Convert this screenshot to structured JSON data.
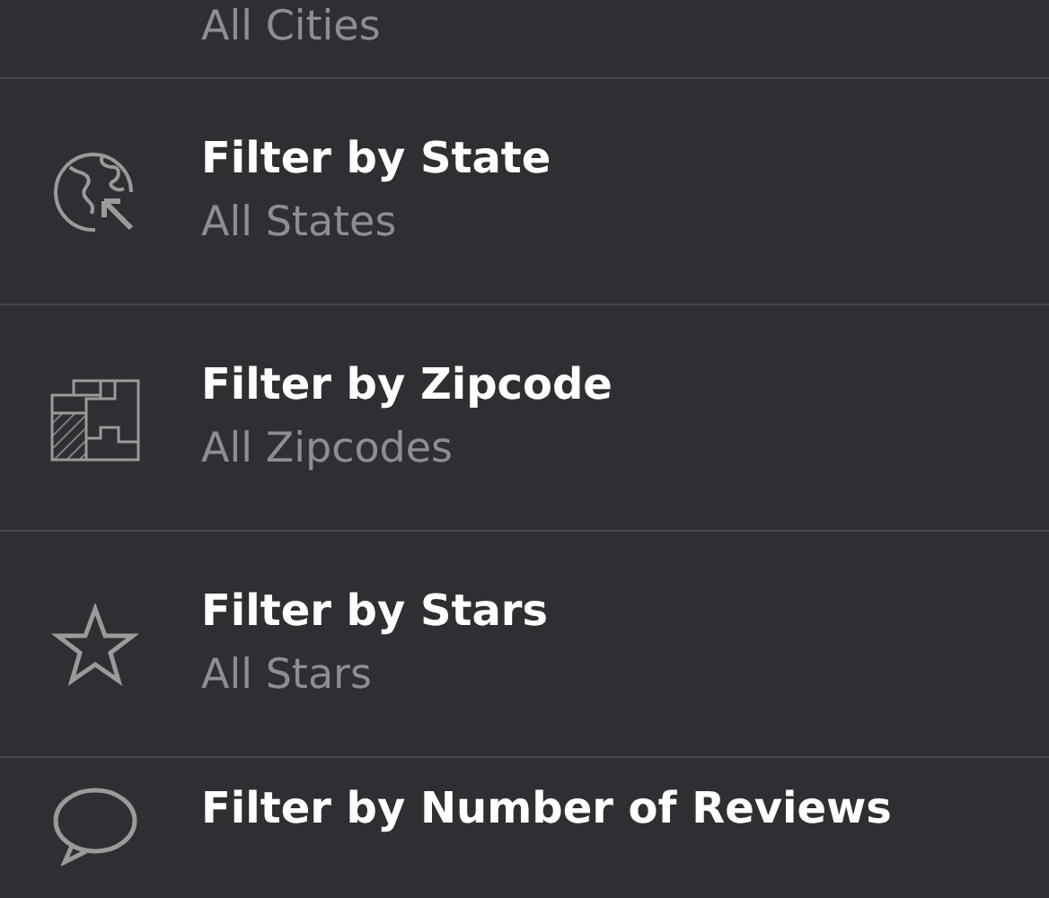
{
  "filters": [
    {
      "subtitle": "All Cities"
    },
    {
      "kind": "globe",
      "title": "Filter by State",
      "subtitle": "All States"
    },
    {
      "kind": "map",
      "title": "Filter by Zipcode",
      "subtitle": "All Zipcodes"
    },
    {
      "kind": "star",
      "title": "Filter by Stars",
      "subtitle": "All Stars"
    },
    {
      "kind": "bubble",
      "title": "Filter by Number of Reviews"
    }
  ]
}
